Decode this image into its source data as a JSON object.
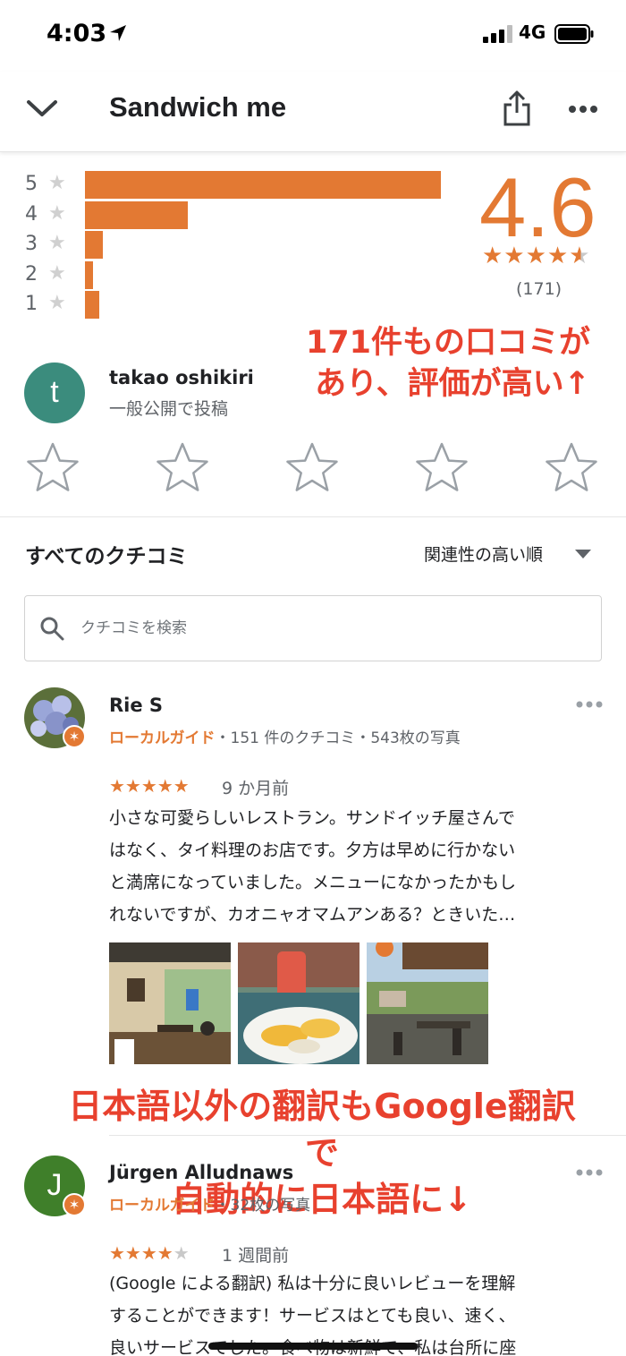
{
  "status": {
    "time": "4:03",
    "network": "4G"
  },
  "header": {
    "title": "Sandwich me"
  },
  "ratings": {
    "score": "4.6",
    "count": "(171)",
    "distribution": [
      {
        "star": "5",
        "fraction": 1.0
      },
      {
        "star": "4",
        "fraction": 0.29
      },
      {
        "star": "3",
        "fraction": 0.05
      },
      {
        "star": "2",
        "fraction": 0.02
      },
      {
        "star": "1",
        "fraction": 0.04
      }
    ],
    "average_stars": 4.6
  },
  "annotations": {
    "note1_line1": "171件もの口コミが",
    "note1_line2": "あり、評価が高い↑",
    "note2_line1": "日本語以外の翻訳もGoogle翻訳で",
    "note2_line2": "自動的に日本語に↓"
  },
  "user": {
    "initial": "t",
    "name": "takao oshikiri",
    "subtitle": "一般公開で投稿"
  },
  "reviews_section": {
    "title": "すべてのクチコミ",
    "sort_label": "関連性の高い順",
    "search_placeholder": "クチコミを検索"
  },
  "reviews": [
    {
      "name": "Rie S",
      "guide": "ローカルガイド",
      "meta": "・151 件のクチコミ・543枚の写真",
      "stars": 5,
      "time": "9 か月前",
      "lines": [
        "小さな可愛らしいレストラン。サンドイッチ屋さんで",
        "はなく、タイ料理のお店です。夕方は早めに行かない",
        "と満席になっていました。メニューになかったかもし",
        "れないですが、カオニャオマムアンある？ときいた…"
      ]
    },
    {
      "name": "Jürgen Alludnaws",
      "initial": "J",
      "guide": "ローカルガイド",
      "meta": "・32枚の写真",
      "stars": 4,
      "time": "1 週間前",
      "lines": [
        "(Google による翻訳) 私は十分に良いレビューを理解",
        "することができます！サービスはとても良い、速く、",
        "良いサービスでした。食べ物は新鮮で、私は台所に座"
      ]
    }
  ],
  "colors": {
    "accent": "#e37933",
    "annotation": "#e8412e",
    "avatar_t": "#3b8c7d",
    "avatar_j": "#3f7f2a"
  },
  "icons": [
    "location-arrow-icon",
    "signal-icon",
    "battery-icon",
    "chevron-down-icon",
    "share-icon",
    "more-icon",
    "search-icon",
    "star-outline-icon",
    "local-guide-badge-icon"
  ]
}
